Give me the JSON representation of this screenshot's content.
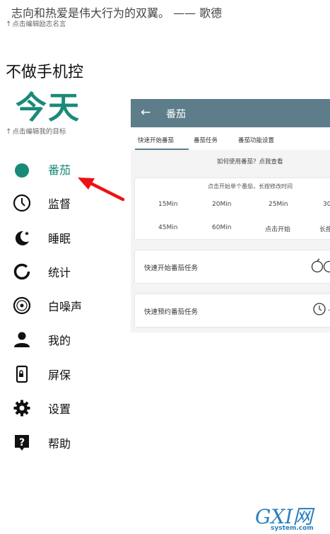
{
  "quote": {
    "text": "志向和热爱是伟大行为的双翼。 —— 歌德",
    "hint": "点击编辑励志名言"
  },
  "slogan": "不做手机控",
  "today": {
    "text": "今天",
    "hint": "点击编辑我的目标"
  },
  "nav": {
    "items": [
      {
        "label": "番茄",
        "icon": "tomato-icon"
      },
      {
        "label": "监督",
        "icon": "clock-icon"
      },
      {
        "label": "睡眠",
        "icon": "moon-icon"
      },
      {
        "label": "统计",
        "icon": "ring-chart-icon"
      },
      {
        "label": "白噪声",
        "icon": "disc-icon"
      },
      {
        "label": "我的",
        "icon": "person-icon"
      },
      {
        "label": "屏保",
        "icon": "phone-lock-icon"
      },
      {
        "label": "设置",
        "icon": "gear-icon"
      },
      {
        "label": "帮助",
        "icon": "help-icon"
      }
    ],
    "active_color": "#1a8a78"
  },
  "panel": {
    "title": "番茄",
    "back_icon": "arrow-left-icon",
    "tabs": [
      "快速开始番茄",
      "番茄任务",
      "番茄功能设置"
    ],
    "howto": "如何使用番茄？点我查看",
    "grid": {
      "hint": "点击开始单个番茄，长按修改时间",
      "row1": [
        "15Min",
        "20Min",
        "25Min",
        "30"
      ],
      "row2": [
        "45Min",
        "60Min",
        "点击开始",
        "长按"
      ]
    },
    "quick_start": {
      "label": "快速开始番茄任务",
      "icon": "apple-timer-icon"
    },
    "quick_reserve": {
      "label": "快速预约番茄任务",
      "icon": "clock-icon",
      "suffix": "—"
    },
    "bar_color": "#5e7d8a"
  },
  "watermark": {
    "main": "GXI网",
    "sub": "system.com"
  }
}
